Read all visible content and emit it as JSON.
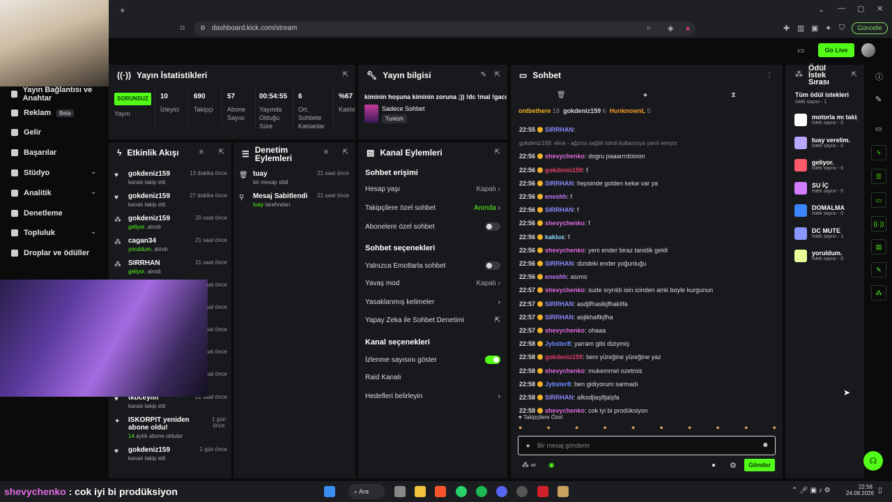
{
  "browser": {
    "url": "dashboard.kick.com/stream",
    "update_label": "Güncelle",
    "new_tab": "+"
  },
  "header": {
    "go_live": "Go Live"
  },
  "nav": {
    "items": [
      {
        "label": "Yayın Bağlantısı ve Anahtar"
      },
      {
        "label": "Reklam",
        "badge": "Beta"
      },
      {
        "label": "Gelir"
      },
      {
        "label": "Başarılar"
      },
      {
        "label": "Stüdyo"
      },
      {
        "label": "Analitik"
      },
      {
        "label": "Denetleme"
      },
      {
        "label": "Topluluk"
      },
      {
        "label": "Droplar ve ödüller"
      }
    ]
  },
  "stats": {
    "title": "Yayın İstatistikleri",
    "items": [
      {
        "value": "SORUNSUZ",
        "label": "Yayın"
      },
      {
        "value": "10",
        "label": "İzleyici"
      },
      {
        "value": "690",
        "label": "Takipçi"
      },
      {
        "value": "57",
        "label": "Abone Sayısı"
      },
      {
        "value": "00:54:55",
        "label": "Yayında Olduğu Süre"
      },
      {
        "value": "6",
        "label": "Ort. Sohbete Katılanlar"
      },
      {
        "value": "%67",
        "label": "Katılım"
      }
    ]
  },
  "info": {
    "title": "Yayın bilgisi",
    "stream_title": "kiminin hoşuna kiminin zoruna ;)) !dc !mal !gacı",
    "category": "Sadece Sohbet",
    "language": "Turkish"
  },
  "activity": {
    "title": "Etkinlik Akışı",
    "items": [
      {
        "name": "gokdeniz159",
        "sub": "kanalı takip etti",
        "time": "13 dakika önce"
      },
      {
        "name": "gokdeniz159",
        "sub": "kanalı takip etti",
        "time": "27 dakika önce"
      },
      {
        "name": "gokdeniz159",
        "sub_green": "geliyor.",
        "sub": " alındı",
        "time": "20 saat önce"
      },
      {
        "name": "cagan34",
        "sub_green": "yoruldum.",
        "sub": " alındı",
        "time": "21 saat önce"
      },
      {
        "name": "SIRRHAN",
        "sub_green": "geliyor.",
        "sub": " alındı",
        "time": "21 saat önce"
      },
      {
        "name": "tkbceylin",
        "sub": "kanalı takip etti",
        "time": "22 saat önce"
      },
      {
        "name": "ISKORPIT yeniden abone oldu!",
        "sub_green": "14",
        "sub": " aylık abone oldular",
        "time": "1 gün önce"
      },
      {
        "name": "gokdeniz159",
        "sub": "kanalı takip etti",
        "time": "1 gün önce"
      }
    ],
    "hidden_times": [
      "21 saat önce",
      "21 saat önce",
      "21 saat önce",
      "21 saat önce",
      "21 saat önce"
    ]
  },
  "mod": {
    "title": "Denetim Eylemleri",
    "items": [
      {
        "name": "tuay",
        "sub": "bir mesajı sildi",
        "time": "21 saat önce"
      },
      {
        "name": "Mesaj Sabitlendi",
        "sub_green": "tuay",
        "sub": " tarafından",
        "time": "21 saat önce"
      }
    ]
  },
  "channel": {
    "title": "Kanal Eylemleri",
    "chat_access": "Sohbet erişimi",
    "account_age": "Hesap yaşı",
    "account_age_val": "Kapalı",
    "followers_chat": "Takipçilere özel sohbet",
    "followers_chat_val": "Anında",
    "subs_chat": "Abonelere özel sohbet",
    "chat_options": "Sohbet seçenekleri",
    "emote_only": "Yalnızca Emotlarla sohbet",
    "slow_mode": "Yavaş mod",
    "slow_mode_val": "Kapalı",
    "banned_words": "Yasaklanmış kelimeler",
    "ai_mod": "Yapay Zeka ile Sohbet Denetimi",
    "channel_options": "Kanal seçenekleri",
    "show_viewers": "İzlenme sayısını göster",
    "raid": "Raid Kanalı",
    "goals": "Hedefleri belirleyin"
  },
  "chat": {
    "title": "Sohbet",
    "top": [
      {
        "name": "ontbethere",
        "count": "18"
      },
      {
        "name": "gokdeniz159",
        "count": "6"
      },
      {
        "name": "HunknownL",
        "count": "5"
      }
    ],
    "messages": [
      {
        "time": "22:55",
        "user": "SIRRHAN",
        "color": "#8a8cff",
        "text": ":"
      },
      {
        "reply": "gokdeniz159: eline - ağzına sağlık isimli kullanıcıya yanıt veriyor"
      },
      {
        "time": "22:56",
        "user": "shevychenko",
        "color": "#e06be0",
        "text": ": dogru paaarrrdoioon"
      },
      {
        "time": "22:56",
        "user": "gokdeniz159",
        "color": "#e0406b",
        "text": ": f"
      },
      {
        "time": "22:56",
        "user": "SIRRHAN",
        "color": "#8a8cff",
        "text": ": hepsinde golden kekw var ya"
      },
      {
        "time": "22:56",
        "user": "eneshh",
        "color": "#c078ff",
        "text": ": f"
      },
      {
        "time": "22:56",
        "user": "SIRRHAN",
        "color": "#8a8cff",
        "text": ": f"
      },
      {
        "time": "22:56",
        "user": "shevychenko",
        "color": "#e06be0",
        "text": ": f"
      },
      {
        "time": "22:56",
        "user": "kaklus",
        "color": "#8ad8ff",
        "text": ": f"
      },
      {
        "time": "22:56",
        "user": "shevychenko",
        "color": "#e06be0",
        "text": ": yeni ender biraz tanidik geldi"
      },
      {
        "time": "22:56",
        "user": "SIRRHAN",
        "color": "#8a8cff",
        "text": ": dizideki ender yoğunluğu"
      },
      {
        "time": "22:56",
        "user": "eneshh",
        "color": "#c078ff",
        "text": ": asıms"
      },
      {
        "time": "22:57",
        "user": "shevychenko",
        "color": "#e06be0",
        "text": ": sude sıyrıldı isin icinden amk boyle kurgunun"
      },
      {
        "time": "22:57",
        "user": "SIRRHAN",
        "color": "#8a8cff",
        "text": ": asdjlfhaslkjfhaklifa"
      },
      {
        "time": "22:57",
        "user": "SIRRHAN",
        "color": "#8a8cff",
        "text": ": asjlkhaflkjfha"
      },
      {
        "time": "22:57",
        "user": "shevychenko",
        "color": "#e06be0",
        "text": ": ohaaa"
      },
      {
        "time": "22:58",
        "user": "Jybster8",
        "color": "#6b8cff",
        "text": ": yarram gibi diziymiş"
      },
      {
        "time": "22:58",
        "user": "gokdeniz159",
        "color": "#e0406b",
        "text": ": beni yüreğine yüreğine yaz"
      },
      {
        "time": "22:58",
        "user": "shevychenko",
        "color": "#e06be0",
        "text": ": mukemmel ozetmis"
      },
      {
        "time": "22:58",
        "user": "Jybster8",
        "color": "#6b8cff",
        "text": ": ben gidiyorum sarmadı"
      },
      {
        "time": "22:58",
        "user": "SIRRHAN",
        "color": "#8a8cff",
        "text": ": afksdjlaşlfjalşfa"
      },
      {
        "time": "22:58",
        "user": "shevychenko",
        "color": "#e06be0",
        "text": ": cok iyi bi prodüksiyon"
      }
    ],
    "followers_only": "Takipçilere Özel",
    "input_placeholder": "Bir mesaj gönderin",
    "send": "Gönder"
  },
  "rewards": {
    "title": "Ödül İstek Sırası",
    "all": "Tüm ödül istekleri",
    "all_count": "İstek sayısı - 1",
    "items": [
      {
        "name": "motorla mı takip et",
        "count": "İstek sayısı - 0",
        "color": "#ffffff"
      },
      {
        "name": "tuay verelim.",
        "count": "İstek sayısı - 0",
        "color": "#b9a6ff"
      },
      {
        "name": "geliyor.",
        "count": "İstek sayısı - 0",
        "color": "#ff5a6b"
      },
      {
        "name": "SU İÇ",
        "count": "İstek sayısı - 0",
        "color": "#d27cff"
      },
      {
        "name": "DOMALMA",
        "count": "İstek sayısı - 0",
        "color": "#3b86ff"
      },
      {
        "name": "DC MUTE",
        "count": "İstek sayısı - 1",
        "color": "#8a96ff"
      },
      {
        "name": "yoruldum.",
        "count": "İstek sayısı - 0",
        "color": "#eaff9a"
      }
    ]
  },
  "overlay": {
    "caption_user": "shevychenko",
    "caption_text": " : cok iyi bi prodüksiyon"
  },
  "taskbar": {
    "search": "Ara",
    "time": "22:58",
    "date": "24.08.2026"
  }
}
